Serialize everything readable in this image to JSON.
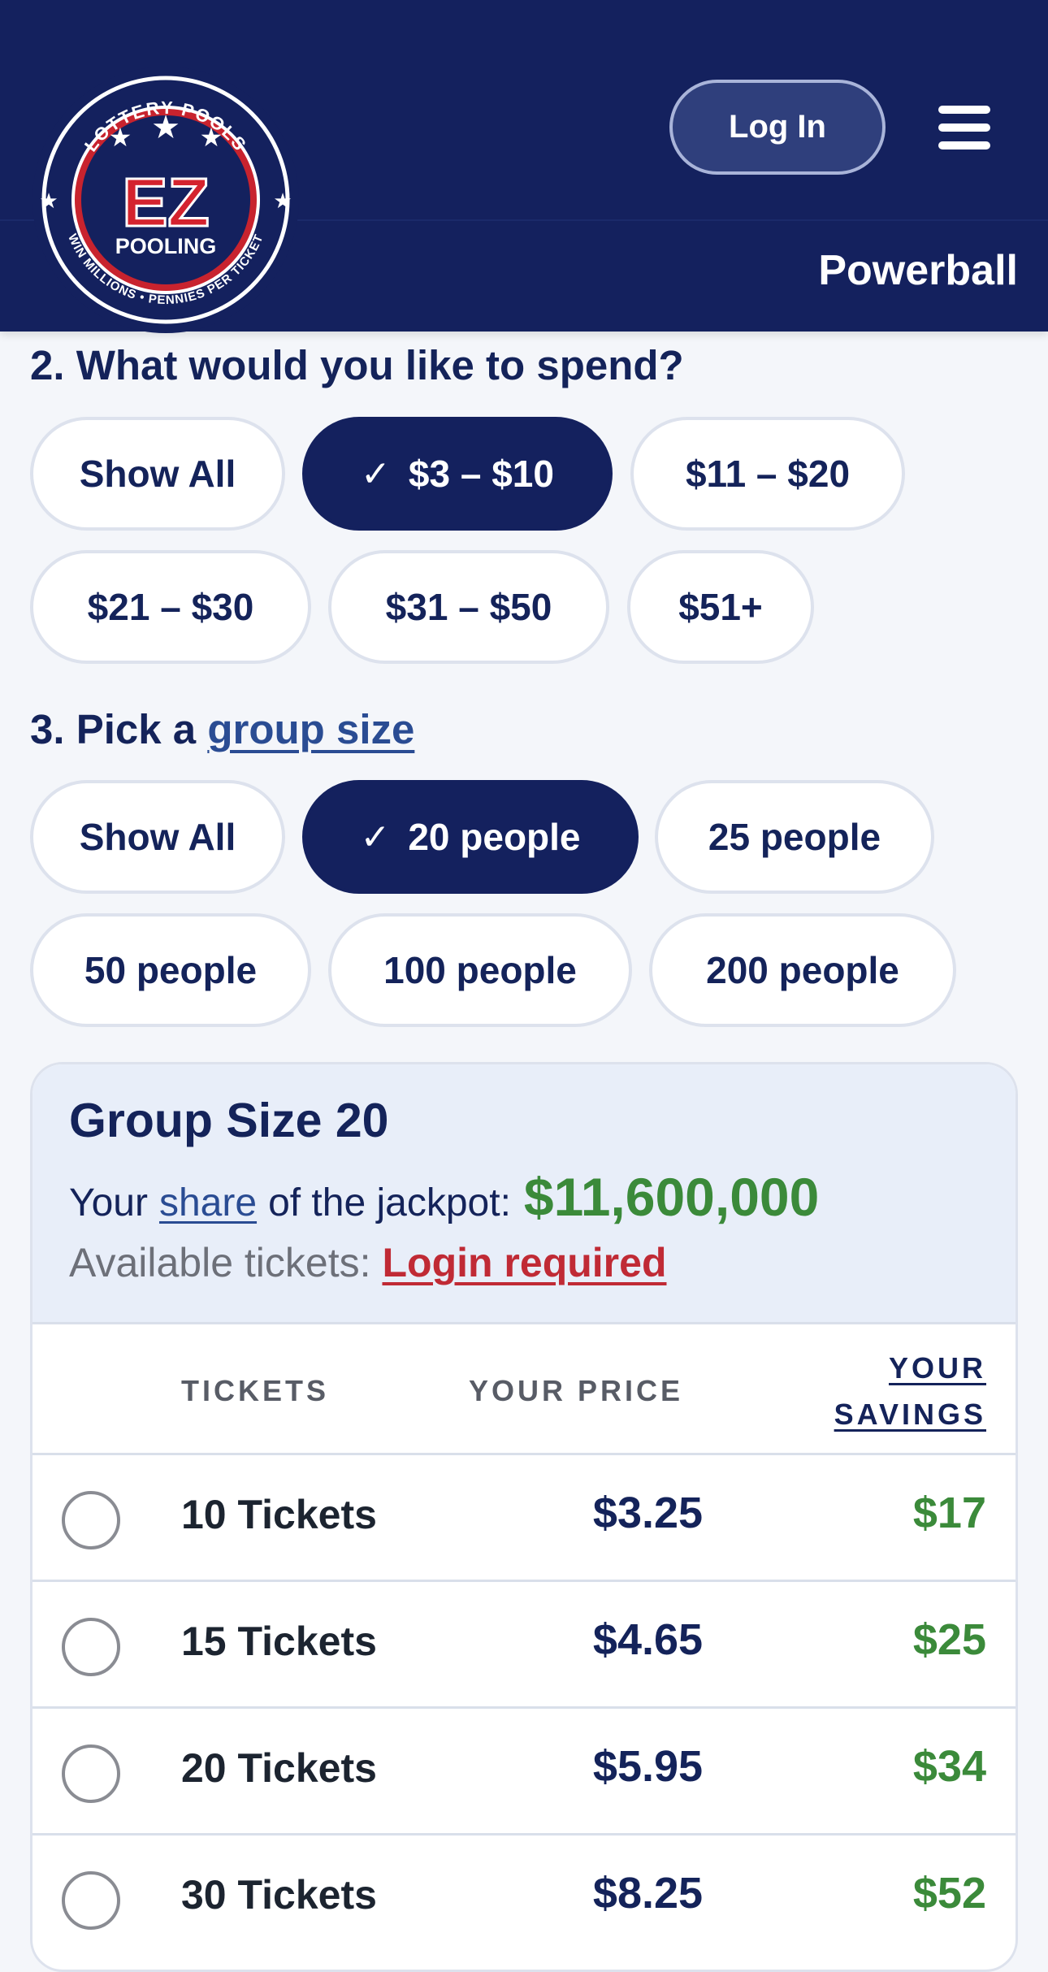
{
  "header": {
    "logo": {
      "top_arc_text": "LOTTERY POOLS",
      "main_text": "EZ",
      "sub_text": "POOLING",
      "bottom_arc_text": "WIN MILLIONS • PENNIES PER TICKET"
    },
    "login_label": "Log In",
    "menu_icon": "hamburger-menu-icon",
    "game_title": "Powerball"
  },
  "spend": {
    "title": "2. What would you like to spend?",
    "options": [
      {
        "label": "Show All",
        "selected": false
      },
      {
        "label": "$3 – $10",
        "selected": true
      },
      {
        "label": "$11 – $20",
        "selected": false
      },
      {
        "label": "$21 – $30",
        "selected": false
      },
      {
        "label": "$31 – $50",
        "selected": false
      },
      {
        "label": "$51+",
        "selected": false
      }
    ]
  },
  "group": {
    "title_prefix": "3. Pick a",
    "title_link": "group size",
    "options": [
      {
        "label": "Show All",
        "selected": false
      },
      {
        "label": "20 people",
        "selected": true
      },
      {
        "label": "25 people",
        "selected": false
      },
      {
        "label": "50 people",
        "selected": false
      },
      {
        "label": "100 people",
        "selected": false
      },
      {
        "label": "200 people",
        "selected": false
      }
    ]
  },
  "card": {
    "title": "Group Size 20",
    "share_prefix": "Your",
    "share_link": "share",
    "share_suffix": "of the jackpot:",
    "share_amount": "$11,600,000",
    "available_label": "Available tickets:",
    "available_value": "Login required",
    "columns": {
      "tickets": "TICKETS",
      "price": "YOUR PRICE",
      "savings_line1": "YOUR",
      "savings_line2": "SAVINGS"
    },
    "rows": [
      {
        "tickets": "10 Tickets",
        "price": "$3.25",
        "savings": "$17"
      },
      {
        "tickets": "15 Tickets",
        "price": "$4.65",
        "savings": "$25"
      },
      {
        "tickets": "20 Tickets",
        "price": "$5.95",
        "savings": "$34"
      },
      {
        "tickets": "30 Tickets",
        "price": "$8.25",
        "savings": "$52"
      }
    ]
  },
  "colors": {
    "navy": "#14215e",
    "green": "#3b8a3a",
    "red": "#c02a35",
    "link_blue": "#2a4c93"
  }
}
